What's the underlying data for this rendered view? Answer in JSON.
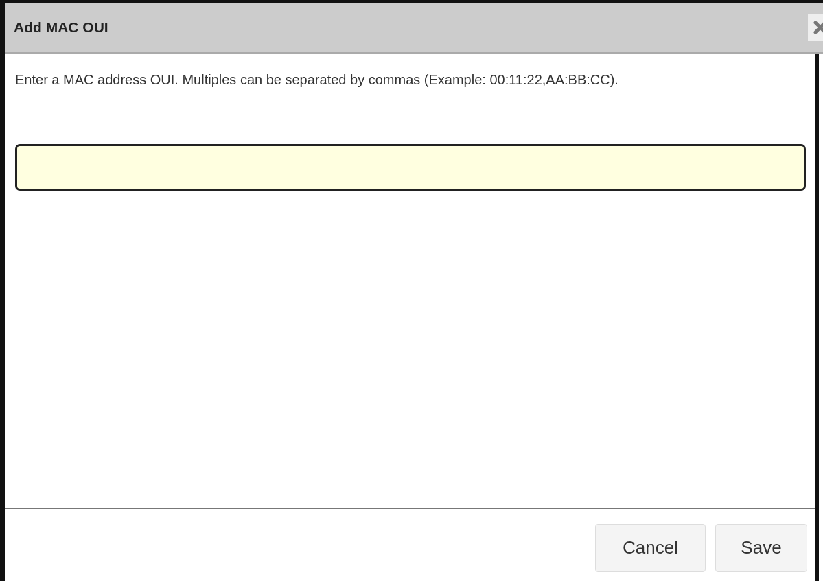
{
  "dialog": {
    "title": "Add MAC OUI",
    "message": "Enter a MAC address OUI. Multiples can be separated by commas (Example: 00:11:22,AA:BB:CC).",
    "input": {
      "focused": true
    },
    "buttons": [
      {
        "label": "Cancel",
        "kind": "cancel"
      },
      {
        "label": "Save",
        "kind": "save"
      }
    ]
  }
}
